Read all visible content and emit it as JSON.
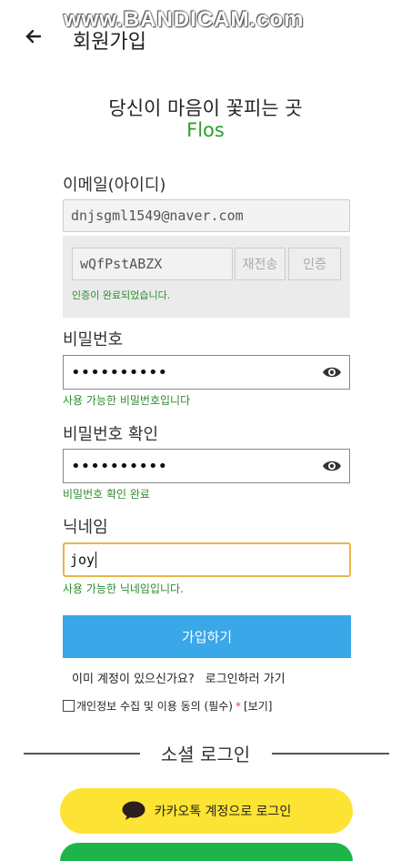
{
  "watermark": "www.BANDICAM.com",
  "header": {
    "back_icon": "arrow-left-icon",
    "title": "회원가입"
  },
  "slogan": "당신이 마음이 꽃피는 곳",
  "brand": "Flos",
  "email": {
    "label": "이메일(아이디)",
    "value": "dnjsgml1549@naver.com"
  },
  "verification": {
    "code": "wQfPstABZX",
    "resend_label": "재전송",
    "verify_label": "인증",
    "message": "인증이 완료되었습니다."
  },
  "password": {
    "label": "비밀번호",
    "value": "••••••••••",
    "message": "사용 가능한 비밀번호입니다",
    "eye_icon": "eye-icon"
  },
  "password_confirm": {
    "label": "비밀번호 확인",
    "value": "••••••••••",
    "message": "비밀번호 확인 완료",
    "eye_icon": "eye-icon"
  },
  "nickname": {
    "label": "닉네임",
    "value": "joy",
    "message": "사용 가능한 닉네임입니다."
  },
  "signup_button": "가입하기",
  "login_prompt": {
    "question": "이미 계정이 있으신가요?",
    "link": "로그인하러 가기"
  },
  "agreement": {
    "text": "개인정보 수집 및 이용 동의 (필수)",
    "required_mark": "*",
    "view_link": "[보기]"
  },
  "social": {
    "title": "소셜 로그인",
    "kakao_label": "카카오톡 계정으로 로그인",
    "kakao_icon": "speech-bubble-icon",
    "kakao_color": "#FDE333",
    "google_color": "#1DB54A"
  },
  "colors": {
    "accent": "#3AA7E8",
    "brand": "#2CA02C",
    "success_text": "#2E8B2E",
    "nickname_focus": "#E8B54A"
  }
}
